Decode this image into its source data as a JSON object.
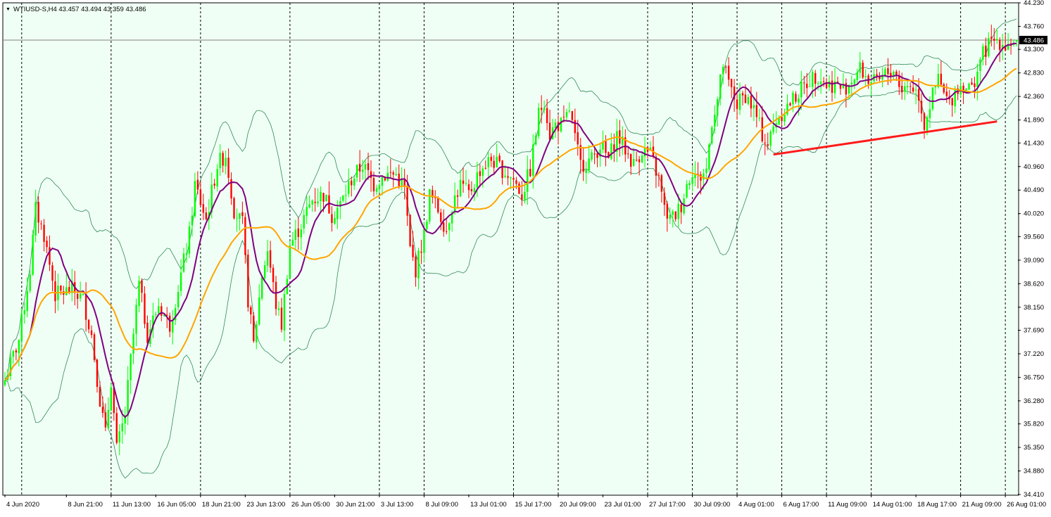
{
  "window": {
    "symbol_header": "WTIUSD-S,H4  43.457 43.494 43.359 43.486",
    "dropdown_glyph": "▼"
  },
  "colors": {
    "background": "#F0FFF5",
    "frame": "#000000",
    "bull_candle": "#00FF00",
    "bear_candle": "#FF0000",
    "fast_ma": "#800080",
    "slow_ma": "#FFA500",
    "bollinger": "#2E8B57",
    "trendline": "#FF1A1A",
    "price_line": "#808080"
  },
  "chart_data": {
    "type": "candlestick",
    "symbol": "WTIUSD-S",
    "timeframe": "H4",
    "ohlc_header": {
      "open": 43.457,
      "high": 43.494,
      "low": 43.359,
      "close": 43.486
    },
    "current_price": 43.486,
    "current_price_label": "43.486",
    "ylim": [
      34.41,
      44.23
    ],
    "y_ticks": [
      "44.230",
      "43.760",
      "43.300",
      "42.830",
      "42.360",
      "41.890",
      "41.430",
      "40.960",
      "40.490",
      "40.020",
      "39.560",
      "39.090",
      "38.620",
      "38.150",
      "37.690",
      "37.220",
      "36.750",
      "36.280",
      "35.820",
      "35.350",
      "34.880",
      "34.410"
    ],
    "x_labels": [
      {
        "label": "4 Jun 2020",
        "index": 0
      },
      {
        "label": "8 Jun 21:00",
        "index": 22
      },
      {
        "label": "11 Jun 13:00",
        "index": 38
      },
      {
        "label": "16 Jun 05:00",
        "index": 54
      },
      {
        "label": "18 Jun 21:00",
        "index": 70
      },
      {
        "label": "23 Jun 13:00",
        "index": 86
      },
      {
        "label": "26 Jun 05:00",
        "index": 102
      },
      {
        "label": "30 Jun 21:00",
        "index": 118
      },
      {
        "label": "3 Jul 13:00",
        "index": 134
      },
      {
        "label": "8 Jul 09:00",
        "index": 150
      },
      {
        "label": "13 Jul 01:00",
        "index": 166
      },
      {
        "label": "15 Jul 17:00",
        "index": 182
      },
      {
        "label": "20 Jul 09:00",
        "index": 198
      },
      {
        "label": "23 Jul 01:00",
        "index": 214
      },
      {
        "label": "27 Jul 17:00",
        "index": 230
      },
      {
        "label": "30 Jul 09:00",
        "index": 246
      },
      {
        "label": "4 Aug 01:00",
        "index": 262
      },
      {
        "label": "6 Aug 17:00",
        "index": 278
      },
      {
        "label": "11 Aug 09:00",
        "index": 294
      },
      {
        "label": "14 Aug 01:00",
        "index": 310
      },
      {
        "label": "18 Aug 17:00",
        "index": 326
      },
      {
        "label": "21 Aug 09:00",
        "index": 342
      },
      {
        "label": "26 Aug 01:00",
        "index": 358
      }
    ],
    "vertical_gridlines_at_index": [
      6,
      38,
      70,
      102,
      134,
      150,
      182,
      198,
      230,
      246,
      262,
      278,
      294,
      310,
      342,
      358
    ],
    "candle_count": 363,
    "close_anchors": [
      [
        0,
        36.7
      ],
      [
        5,
        37.5
      ],
      [
        9,
        38.9
      ],
      [
        11,
        40.1
      ],
      [
        14,
        39.6
      ],
      [
        18,
        38.4
      ],
      [
        24,
        38.5
      ],
      [
        28,
        38.3
      ],
      [
        31,
        37.6
      ],
      [
        34,
        36.3
      ],
      [
        36,
        35.6
      ],
      [
        38,
        36.7
      ],
      [
        40,
        35.3
      ],
      [
        43,
        36.0
      ],
      [
        45,
        37.1
      ],
      [
        48,
        38.6
      ],
      [
        51,
        37.6
      ],
      [
        55,
        38.2
      ],
      [
        59,
        37.8
      ],
      [
        63,
        38.8
      ],
      [
        66,
        39.6
      ],
      [
        68,
        40.6
      ],
      [
        72,
        39.9
      ],
      [
        76,
        41.0
      ],
      [
        79,
        41.2
      ],
      [
        82,
        40.1
      ],
      [
        85,
        39.8
      ],
      [
        87,
        38.3
      ],
      [
        89,
        37.4
      ],
      [
        92,
        38.8
      ],
      [
        94,
        39.3
      ],
      [
        97,
        38.2
      ],
      [
        99,
        37.8
      ],
      [
        102,
        39.4
      ],
      [
        106,
        39.8
      ],
      [
        110,
        40.3
      ],
      [
        114,
        40.4
      ],
      [
        117,
        40.0
      ],
      [
        120,
        40.2
      ],
      [
        124,
        40.7
      ],
      [
        128,
        41.0
      ],
      [
        132,
        40.6
      ],
      [
        136,
        40.8
      ],
      [
        140,
        40.8
      ],
      [
        143,
        40.5
      ],
      [
        145,
        39.3
      ],
      [
        147,
        38.9
      ],
      [
        150,
        39.6
      ],
      [
        152,
        40.4
      ],
      [
        155,
        40.1
      ],
      [
        158,
        39.7
      ],
      [
        160,
        40.2
      ],
      [
        163,
        40.6
      ],
      [
        166,
        40.4
      ],
      [
        170,
        40.9
      ],
      [
        174,
        41.1
      ],
      [
        178,
        40.9
      ],
      [
        182,
        40.7
      ],
      [
        185,
        40.4
      ],
      [
        188,
        40.9
      ],
      [
        191,
        42.0
      ],
      [
        193,
        42.3
      ],
      [
        195,
        41.6
      ],
      [
        197,
        41.8
      ],
      [
        200,
        41.8
      ],
      [
        202,
        42.1
      ],
      [
        204,
        41.5
      ],
      [
        206,
        41.0
      ],
      [
        210,
        41.1
      ],
      [
        213,
        41.4
      ],
      [
        216,
        41.1
      ],
      [
        219,
        41.6
      ],
      [
        222,
        41.3
      ],
      [
        225,
        41.0
      ],
      [
        228,
        41.3
      ],
      [
        231,
        41.2
      ],
      [
        234,
        40.7
      ],
      [
        236,
        40.1
      ],
      [
        238,
        39.9
      ],
      [
        240,
        40.0
      ],
      [
        242,
        40.2
      ],
      [
        244,
        40.6
      ],
      [
        246,
        40.9
      ],
      [
        248,
        40.7
      ],
      [
        251,
        40.9
      ],
      [
        253,
        41.9
      ],
      [
        255,
        42.3
      ],
      [
        257,
        43.0
      ],
      [
        259,
        42.6
      ],
      [
        262,
        42.2
      ],
      [
        265,
        42.4
      ],
      [
        268,
        42.1
      ],
      [
        271,
        41.6
      ],
      [
        273,
        41.4
      ],
      [
        276,
        41.9
      ],
      [
        279,
        42.1
      ],
      [
        282,
        42.3
      ],
      [
        285,
        42.5
      ],
      [
        288,
        42.7
      ],
      [
        291,
        42.8
      ],
      [
        294,
        42.6
      ],
      [
        297,
        42.6
      ],
      [
        300,
        42.5
      ],
      [
        303,
        42.7
      ],
      [
        306,
        42.9
      ],
      [
        309,
        42.7
      ],
      [
        312,
        42.6
      ],
      [
        315,
        42.8
      ],
      [
        318,
        42.9
      ],
      [
        321,
        42.5
      ],
      [
        324,
        42.6
      ],
      [
        327,
        42.4
      ],
      [
        329,
        41.8
      ],
      [
        331,
        42.2
      ],
      [
        334,
        42.7
      ],
      [
        336,
        42.4
      ],
      [
        338,
        42.2
      ],
      [
        340,
        42.5
      ],
      [
        343,
        42.6
      ],
      [
        346,
        42.5
      ],
      [
        349,
        43.1
      ],
      [
        352,
        43.4
      ],
      [
        355,
        43.5
      ],
      [
        358,
        43.4
      ],
      [
        362,
        43.486
      ]
    ],
    "series": [
      {
        "name": "",
        "kind": "moving_average",
        "period": 10,
        "color": "#800080"
      },
      {
        "name": "",
        "kind": "moving_average",
        "period": 30,
        "color": "#FFA500"
      },
      {
        "name": "",
        "kind": "bollinger_bands",
        "period": 20,
        "deviation": 2,
        "color": "#2E8B57"
      }
    ],
    "trendline": {
      "from": {
        "index": 275,
        "price": 41.2
      },
      "to": {
        "index": 355,
        "price": 41.86
      },
      "color": "#FF1A1A"
    },
    "grid": false,
    "legend": "none"
  }
}
